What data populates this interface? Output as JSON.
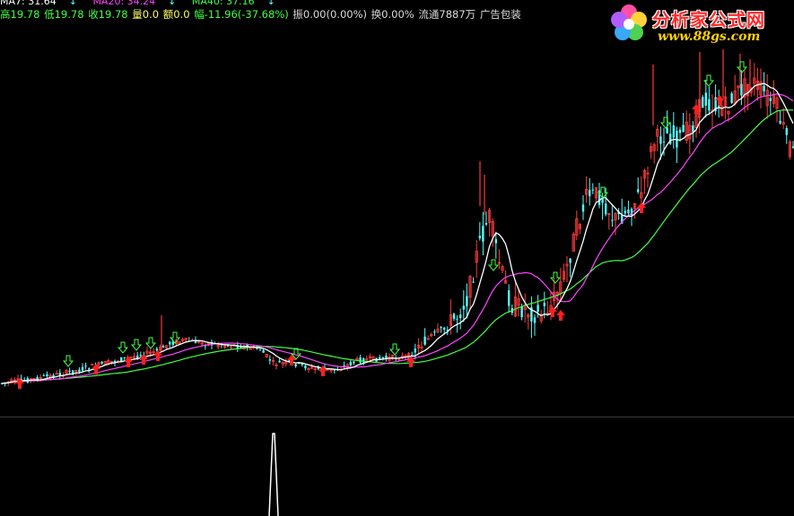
{
  "ma_legend": {
    "items": [
      {
        "text": "MA7: 31.64",
        "arrow": "↓",
        "color": "#ffffff"
      },
      {
        "text": "MA20: 34.24",
        "arrow": "↓",
        "color": "#ff44ff"
      },
      {
        "text": "MA40: 37.16",
        "arrow": "↓",
        "color": "#44ff44"
      }
    ]
  },
  "quote": {
    "high": "高19.78",
    "low": "低19.78",
    "close": "收19.78",
    "volume": "量0.0",
    "amount": "额0.0",
    "change": "幅-11.96(-37.68%)",
    "amplitude": "振0.00(0.00%)",
    "turnover": "换0.00%",
    "float_shares": "流通7887万",
    "sector": "广告包装"
  },
  "logo": {
    "title": "分析家公式网",
    "url": "www.88gs.com"
  },
  "colors": {
    "up": "#ff3b3b",
    "down": "#54ffff",
    "ma7": "#ffffff",
    "ma20": "#ff44ff",
    "ma40": "#44ff44",
    "buy_arrow": "#ff2020",
    "sell_arrow": "#44ff44",
    "indicator": "#ffffff"
  },
  "chart_data": {
    "type": "candlestick",
    "series": [
      {
        "name": "MA7",
        "value": 31.64,
        "trend": "down"
      },
      {
        "name": "MA20",
        "value": 34.24,
        "trend": "down"
      },
      {
        "name": "MA40",
        "value": 37.16,
        "trend": "down"
      }
    ],
    "signals": {
      "buy_count": 12,
      "sell_count": 13
    }
  }
}
